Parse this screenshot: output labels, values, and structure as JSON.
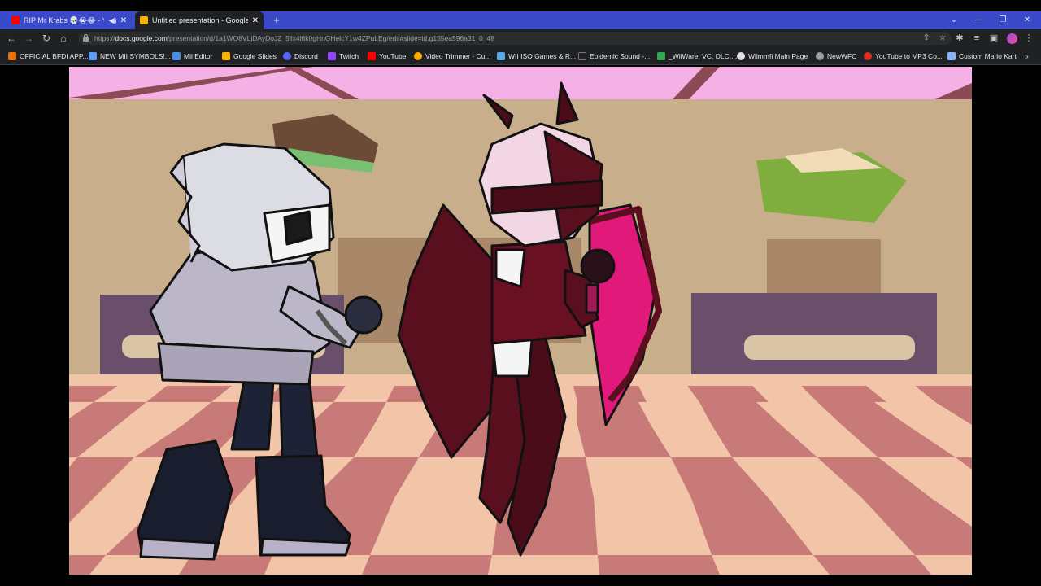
{
  "tabs": [
    {
      "title": "RIP Mr Krabs 💀😭😂 - YouTu",
      "favicon_color": "#ff0000",
      "active": false,
      "muted_icon": "speaker-icon"
    },
    {
      "title": "Untitled presentation - Google Sl",
      "favicon_color": "#f4b400",
      "active": true
    }
  ],
  "new_tab_label": "+",
  "address": {
    "url_prefix": "https://",
    "url_host": "docs.google.com",
    "url_path": "/presentation/d/1a1WO8VLjDAyDoJZ_5iix4i6k0gHnGHelcY1w4ZPuLEg/edit#slide=id.g155ea596a31_0_48"
  },
  "bookmarks": [
    {
      "label": "OFFICIAL BFDI APP...",
      "color": "#e8710a"
    },
    {
      "label": "NEW MII SYMBOLS!...",
      "color": "#5f9cf5"
    },
    {
      "label": "Mii Editor",
      "color": "#4a8fe7"
    },
    {
      "label": "Google Slides",
      "color": "#f4b400"
    },
    {
      "label": "Discord",
      "color": "#5865f2"
    },
    {
      "label": "Twitch",
      "color": "#9146ff"
    },
    {
      "label": "YouTube",
      "color": "#ff0000"
    },
    {
      "label": "Video Trimmer - Cu...",
      "color": "#f9ab00"
    },
    {
      "label": "WII ISO Games & R...",
      "color": "#5aa9e6"
    },
    {
      "label": "Epidemic Sound -...",
      "color": "#222222"
    },
    {
      "label": "_WiiWare, VC, DLC,...",
      "color": "#34a853"
    },
    {
      "label": "Wiimmfi Main Page",
      "color": "#dddddd"
    },
    {
      "label": "NewWFC",
      "color": "#9aa0a6"
    },
    {
      "label": "YouTube to MP3 Co...",
      "color": "#d93025"
    },
    {
      "label": "Custom Mario Kart",
      "color": "#8ab4f8"
    }
  ],
  "colors": {
    "tabbar": "#3949c7",
    "chrome_dark": "#202124",
    "wall_pink": "#f5b0e6",
    "wall_tan": "#c9ae8b",
    "floor_light": "#f2c5a8",
    "floor_dark": "#c77a78"
  }
}
